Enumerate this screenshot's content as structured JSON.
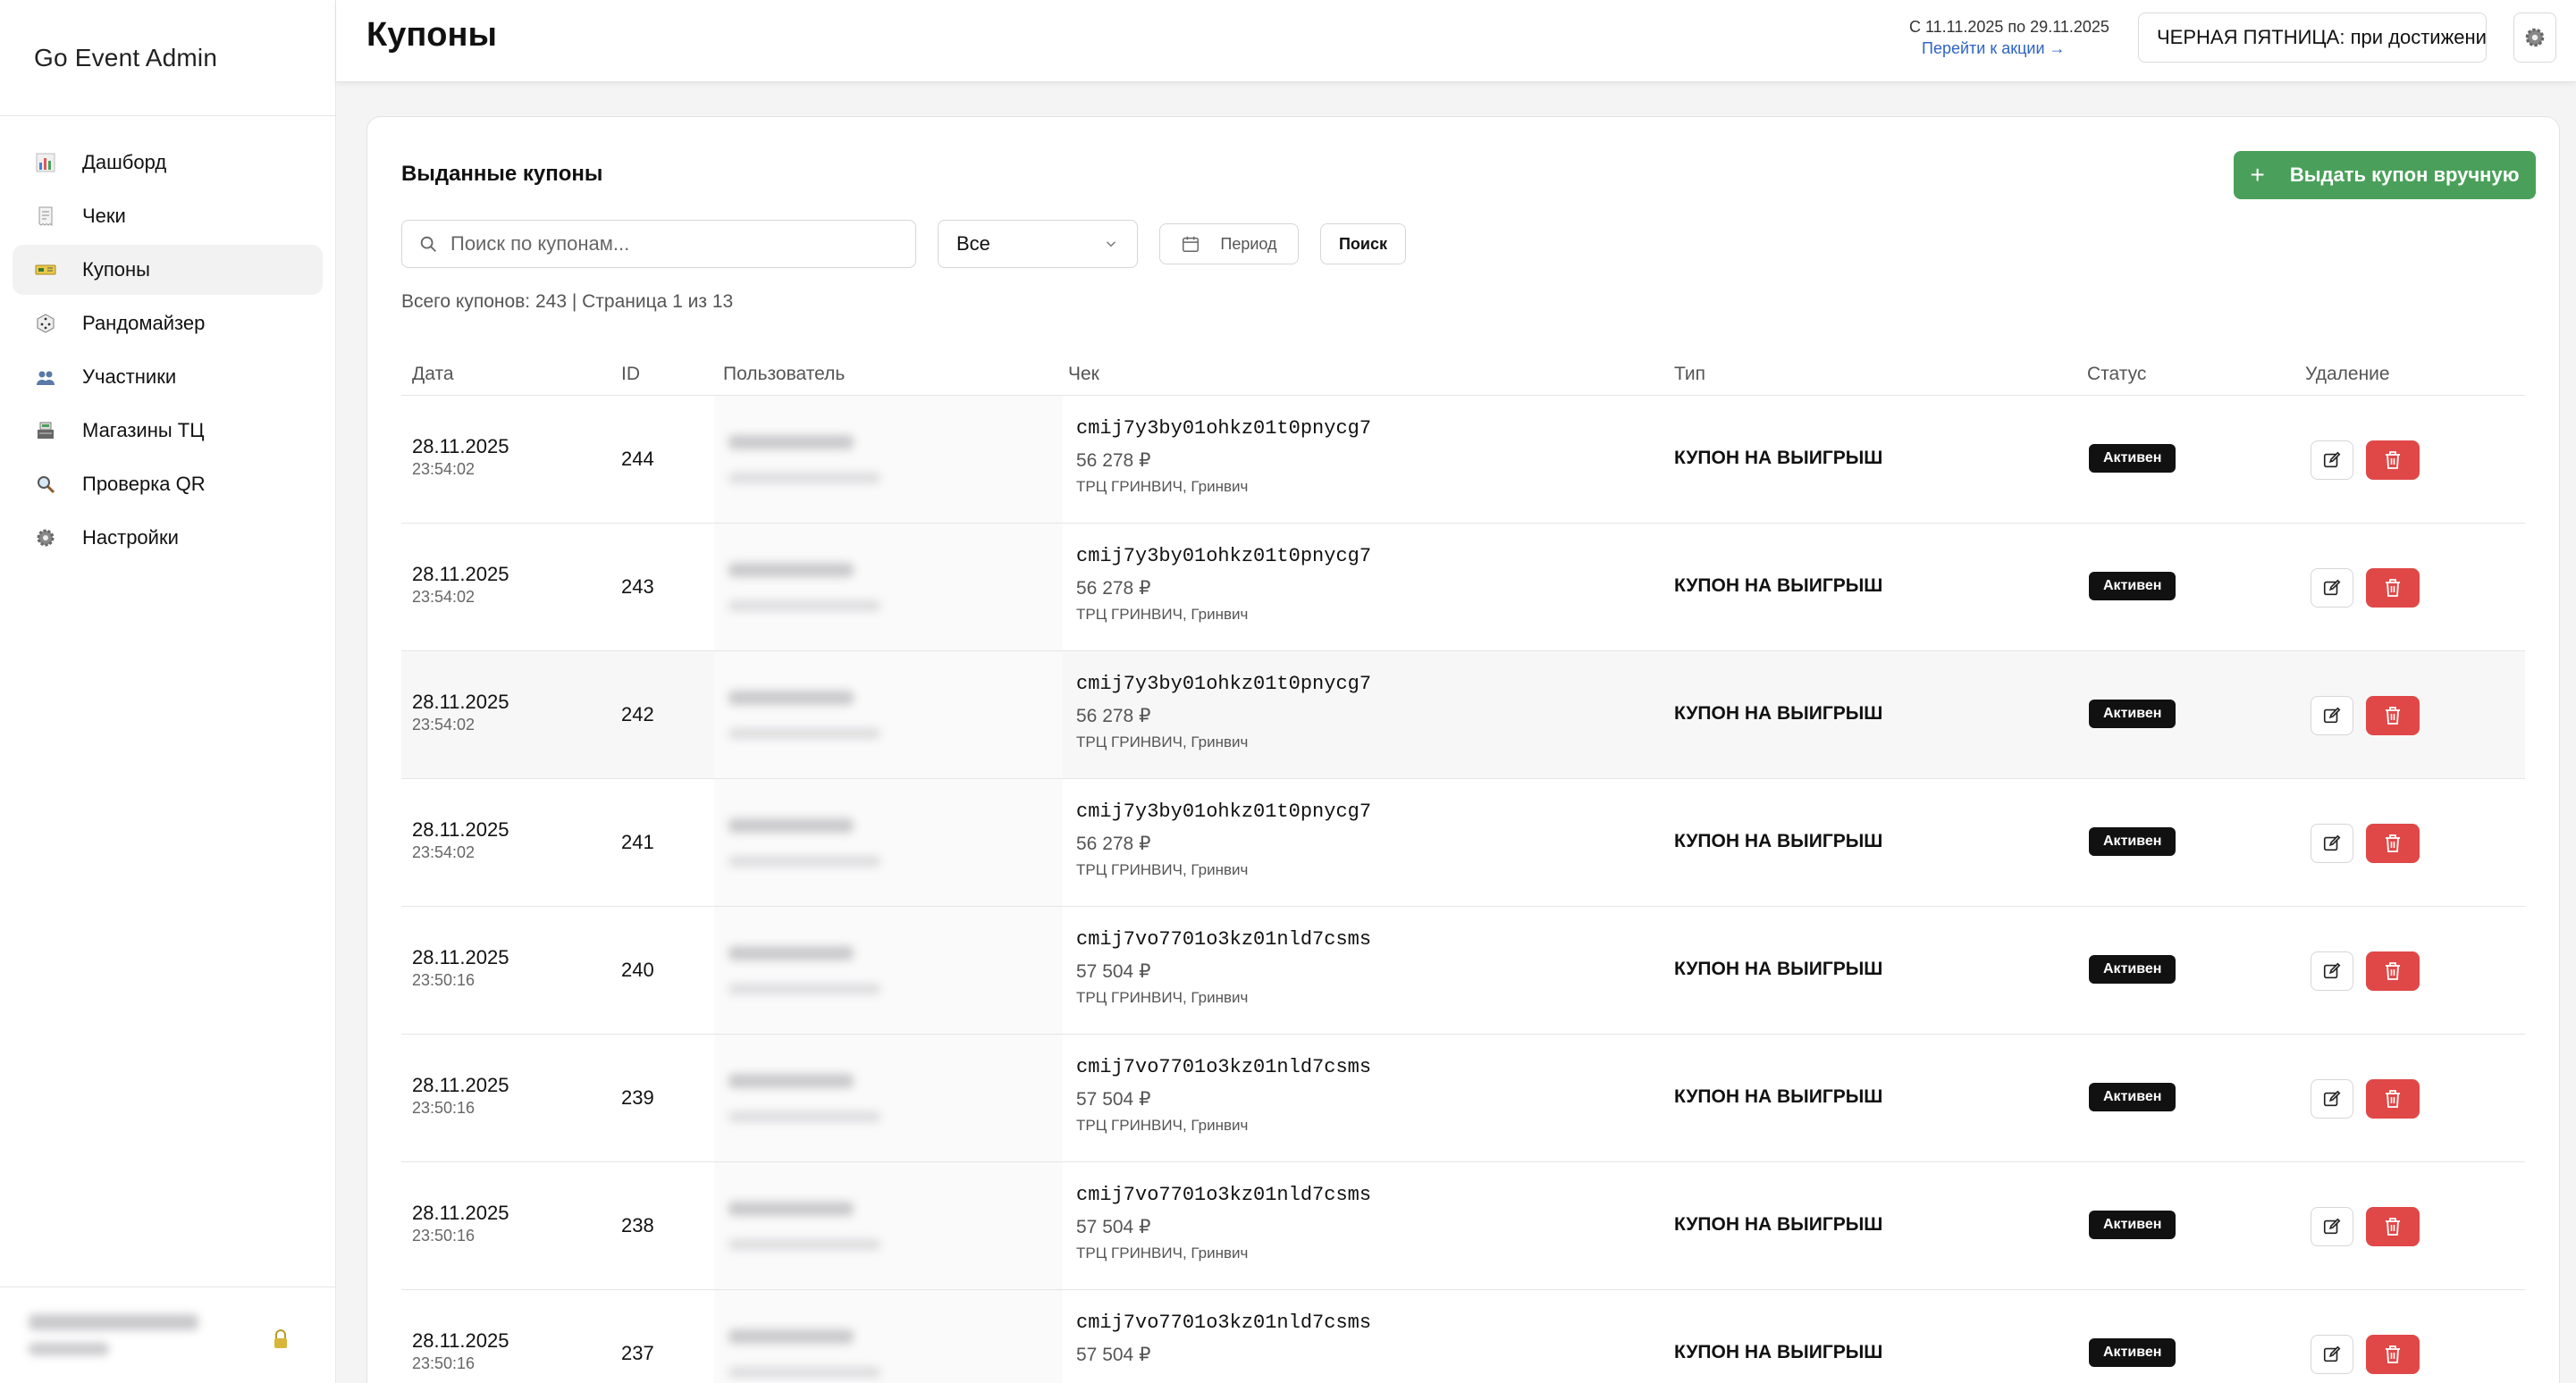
{
  "app": {
    "title": "Go Event Admin"
  },
  "sidebar": {
    "items": [
      {
        "label": "Дашборд",
        "icon": "chart-bar-icon",
        "active": false
      },
      {
        "label": "Чеки",
        "icon": "receipt-icon",
        "active": false
      },
      {
        "label": "Купоны",
        "icon": "ticket-icon",
        "active": true
      },
      {
        "label": "Рандомайзер",
        "icon": "dice-icon",
        "active": false
      },
      {
        "label": "Участники",
        "icon": "people-icon",
        "active": false
      },
      {
        "label": "Магазины ТЦ",
        "icon": "register-icon",
        "active": false
      },
      {
        "label": "Проверка QR",
        "icon": "magnifier-icon",
        "active": false
      },
      {
        "label": "Настройки",
        "icon": "gear-icon",
        "active": false
      }
    ]
  },
  "header": {
    "title": "Купоны",
    "promo_dates": "С 11.11.2025 по 29.11.2025",
    "promo_link": "Перейти к акции →",
    "promo_select": "ЧЕРНАЯ ПЯТНИЦА: при достижении"
  },
  "card": {
    "title": "Выданные купоны",
    "issue_button": "Выдать купон вручную",
    "search_placeholder": "Поиск по купонам...",
    "status_filter": "Все",
    "period_label": "Период",
    "search_button": "Поиск",
    "summary": "Всего купонов: 243 | Страница 1 из 13"
  },
  "table": {
    "columns": [
      "Дата",
      "ID",
      "Пользователь",
      "Чек",
      "Тип",
      "Статус",
      "Удаление"
    ],
    "rows": [
      {
        "date": "28.11.2025",
        "time": "23:54:02",
        "id": "244",
        "check": "cmij7y3by01ohkz01t0pnycg7",
        "sum": "56 278 ₽",
        "mall": "ТРЦ ГРИНВИЧ, Гринвич",
        "type": "КУПОН НА ВЫИГРЫШ",
        "status": "Активен"
      },
      {
        "date": "28.11.2025",
        "time": "23:54:02",
        "id": "243",
        "check": "cmij7y3by01ohkz01t0pnycg7",
        "sum": "56 278 ₽",
        "mall": "ТРЦ ГРИНВИЧ, Гринвич",
        "type": "КУПОН НА ВЫИГРЫШ",
        "status": "Активен"
      },
      {
        "date": "28.11.2025",
        "time": "23:54:02",
        "id": "242",
        "check": "cmij7y3by01ohkz01t0pnycg7",
        "sum": "56 278 ₽",
        "mall": "ТРЦ ГРИНВИЧ, Гринвич",
        "type": "КУПОН НА ВЫИГРЫШ",
        "status": "Активен"
      },
      {
        "date": "28.11.2025",
        "time": "23:54:02",
        "id": "241",
        "check": "cmij7y3by01ohkz01t0pnycg7",
        "sum": "56 278 ₽",
        "mall": "ТРЦ ГРИНВИЧ, Гринвич",
        "type": "КУПОН НА ВЫИГРЫШ",
        "status": "Активен"
      },
      {
        "date": "28.11.2025",
        "time": "23:50:16",
        "id": "240",
        "check": "cmij7vo7701o3kz01nld7csms",
        "sum": "57 504 ₽",
        "mall": "ТРЦ ГРИНВИЧ, Гринвич",
        "type": "КУПОН НА ВЫИГРЫШ",
        "status": "Активен"
      },
      {
        "date": "28.11.2025",
        "time": "23:50:16",
        "id": "239",
        "check": "cmij7vo7701o3kz01nld7csms",
        "sum": "57 504 ₽",
        "mall": "ТРЦ ГРИНВИЧ, Гринвич",
        "type": "КУПОН НА ВЫИГРЫШ",
        "status": "Активен"
      },
      {
        "date": "28.11.2025",
        "time": "23:50:16",
        "id": "238",
        "check": "cmij7vo7701o3kz01nld7csms",
        "sum": "57 504 ₽",
        "mall": "ТРЦ ГРИНВИЧ, Гринвич",
        "type": "КУПОН НА ВЫИГРЫШ",
        "status": "Активен"
      },
      {
        "date": "28.11.2025",
        "time": "23:50:16",
        "id": "237",
        "check": "cmij7vo7701o3kz01nld7csms",
        "sum": "57 504 ₽",
        "mall": "",
        "type": "КУПОН НА ВЫИГРЫШ",
        "status": "Активен"
      }
    ]
  },
  "colors": {
    "accent_green": "#4aa05a",
    "delete_red": "#e04848",
    "status_badge": "#111111",
    "link_blue": "#2e64c6"
  }
}
